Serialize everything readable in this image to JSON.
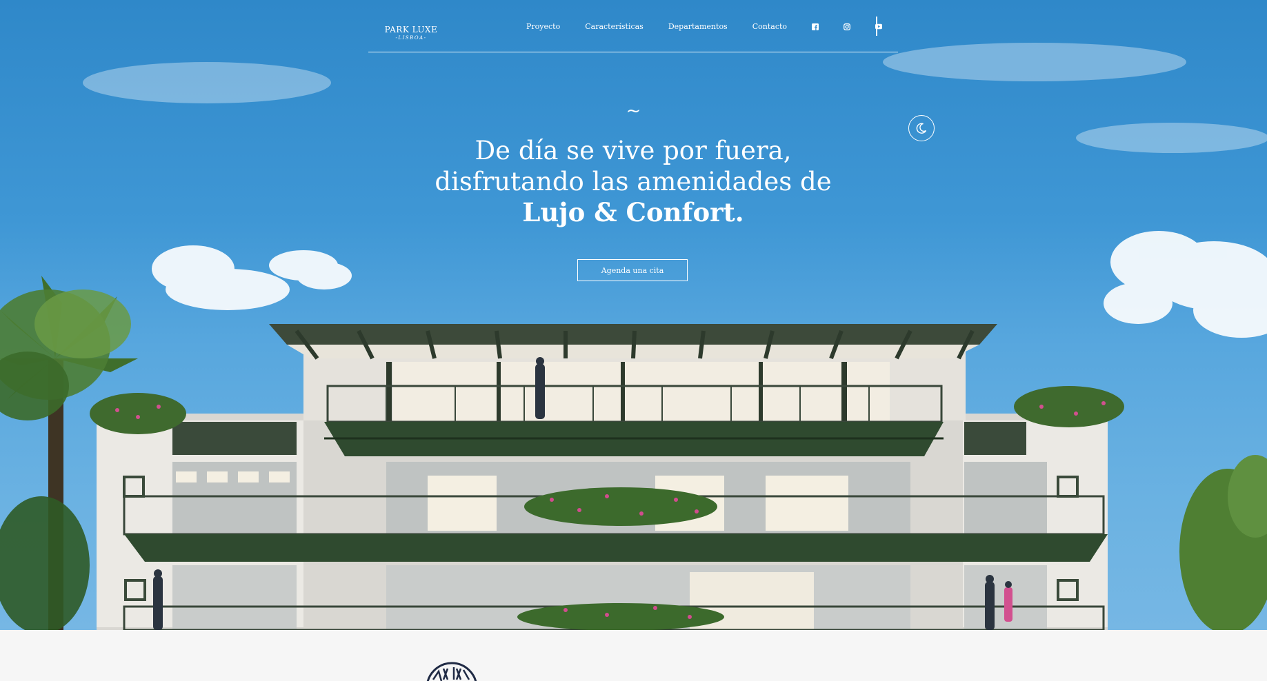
{
  "header": {
    "logo_name": "PARK LUXE",
    "logo_sub": "-LISBOA-",
    "nav": [
      "Proyecto",
      "Características",
      "Departamentos",
      "Contacto"
    ],
    "social_icons": [
      "facebook-icon",
      "instagram-icon",
      "youtube-icon"
    ]
  },
  "hero": {
    "tilde": "~",
    "headline_line1": "De día se vive por fuera,",
    "headline_line2": "disfrutando las amenidades de",
    "headline_strong": "Lujo & Confort.",
    "cta_label": "Agenda una cita",
    "theme_toggle_icon": "moon-icon"
  },
  "colors": {
    "sky_top": "#2f88c9",
    "sky_bottom": "#76b7e4",
    "text": "#ffffff",
    "section_bg": "#f6f6f6",
    "emblem": "#1f2a44"
  }
}
